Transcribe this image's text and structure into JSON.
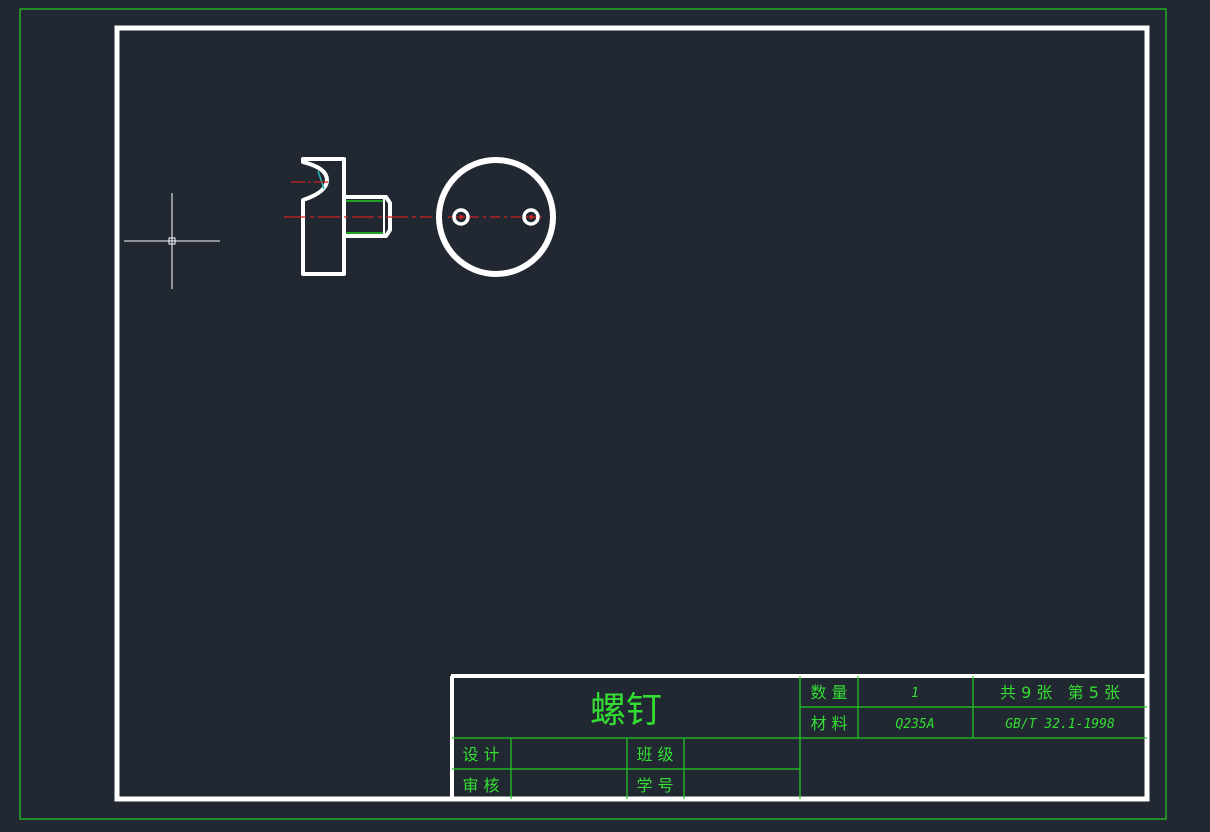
{
  "title_block": {
    "part_name": "螺钉",
    "quantity_label": "数 量",
    "quantity_value": "1",
    "sheet_info": "共 9 张   第 5 张",
    "material_label": "材 料",
    "material_value": "Q235A",
    "standard": "GB/T 32.1-1998",
    "designer_label": "设 计",
    "class_label": "班 级",
    "reviewer_label": "审 核",
    "student_id_label": "学 号"
  },
  "colors": {
    "background": "#222831",
    "outline": "#ffffff",
    "title_block_lines": "#22cc22",
    "text": "#33dd33",
    "center_line": "#cc2222",
    "thread_line": "#22cc22",
    "cursor": "#ffffff"
  },
  "icons": {
    "cursor": "crosshair-cursor-icon"
  }
}
